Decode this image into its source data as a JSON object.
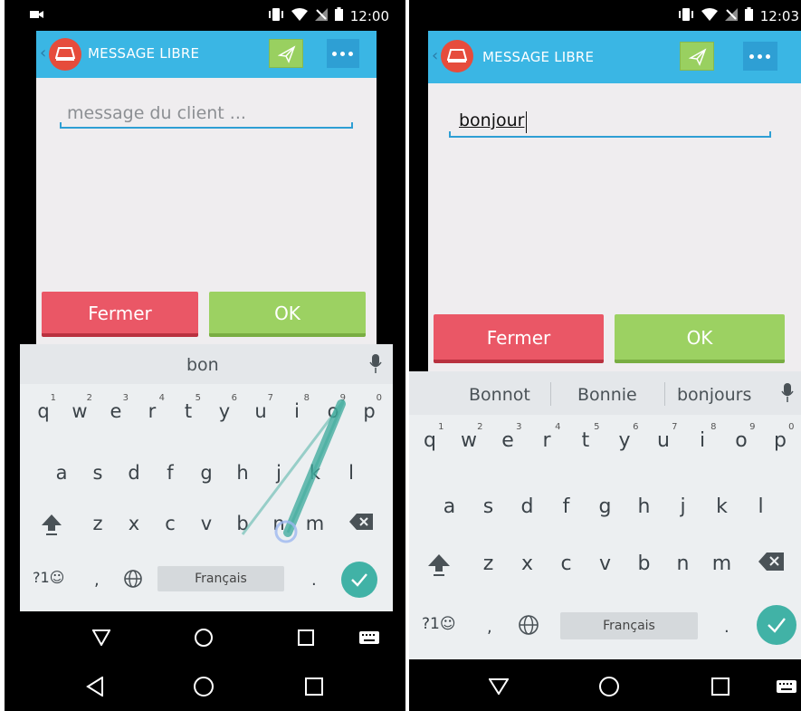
{
  "screen_left": {
    "status": {
      "time": "12:00"
    },
    "app": {
      "title": "MESSAGE LIBRE",
      "input_placeholder": "message du client ...",
      "input_value": "",
      "close_button": "Fermer",
      "ok_button": "OK"
    },
    "keyboard": {
      "suggestions": [
        "bon"
      ],
      "row1": [
        "q",
        "w",
        "e",
        "r",
        "t",
        "y",
        "u",
        "i",
        "o",
        "p"
      ],
      "row1_numbers": [
        "1",
        "2",
        "3",
        "4",
        "5",
        "6",
        "7",
        "8",
        "9",
        "0"
      ],
      "row2": [
        "a",
        "s",
        "d",
        "f",
        "g",
        "h",
        "j",
        "k",
        "l"
      ],
      "row3": [
        "z",
        "x",
        "c",
        "v",
        "b",
        "n",
        "m"
      ],
      "symbols_key": "?1☺",
      "comma_key": ",",
      "space_label": "Français",
      "period_key": "."
    }
  },
  "screen_right": {
    "status": {
      "time": "12:03"
    },
    "app": {
      "title": "MESSAGE LIBRE",
      "input_value": "bonjour",
      "close_button": "Fermer",
      "ok_button": "OK"
    },
    "keyboard": {
      "suggestions": [
        "Bonnot",
        "Bonnie",
        "bonjours"
      ],
      "row1": [
        "q",
        "w",
        "e",
        "r",
        "t",
        "y",
        "u",
        "i",
        "o",
        "p"
      ],
      "row1_numbers": [
        "1",
        "2",
        "3",
        "4",
        "5",
        "6",
        "7",
        "8",
        "9",
        "0"
      ],
      "row2": [
        "a",
        "s",
        "d",
        "f",
        "g",
        "h",
        "j",
        "k",
        "l"
      ],
      "row3": [
        "z",
        "x",
        "c",
        "v",
        "b",
        "n",
        "m"
      ],
      "symbols_key": "?1☺",
      "comma_key": ",",
      "space_label": "Français",
      "period_key": "."
    }
  },
  "colors": {
    "appbar": "#3ab6e4",
    "close_button": "#ea5766",
    "ok_button": "#9cd162",
    "accent_line": "#2e9fd4",
    "enter_key": "#41b2a6"
  }
}
